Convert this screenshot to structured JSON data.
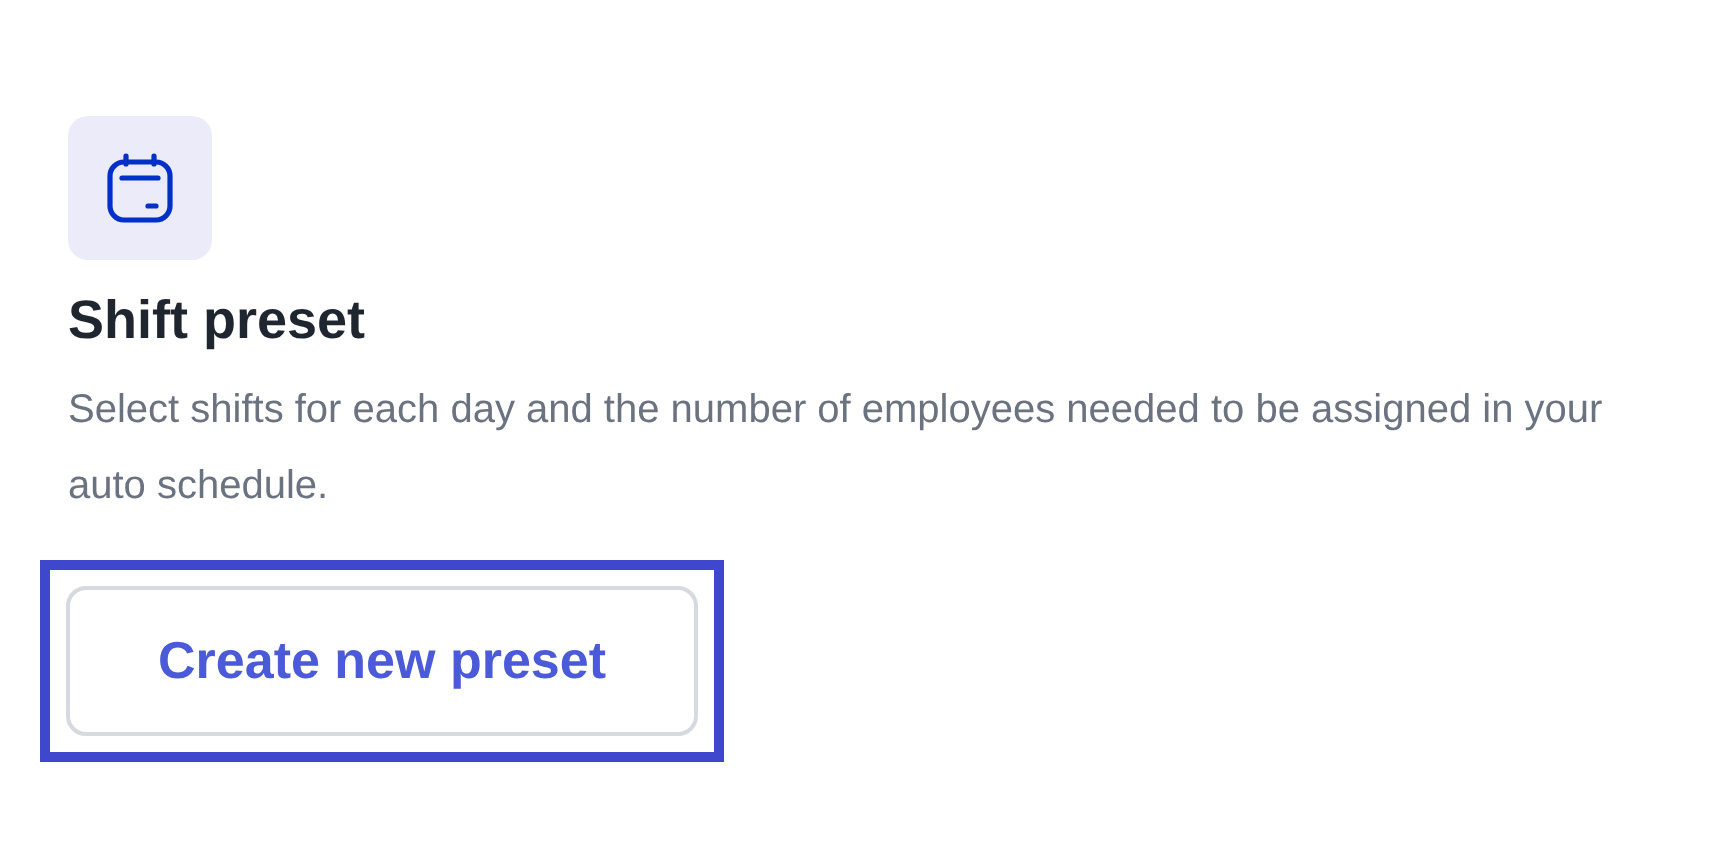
{
  "card": {
    "title": "Shift preset",
    "description": "Select shifts for each day and the number of employees needed to be assigned in your auto schedule.",
    "button": {
      "label": "Create new preset",
      "highlighted": true
    }
  }
}
